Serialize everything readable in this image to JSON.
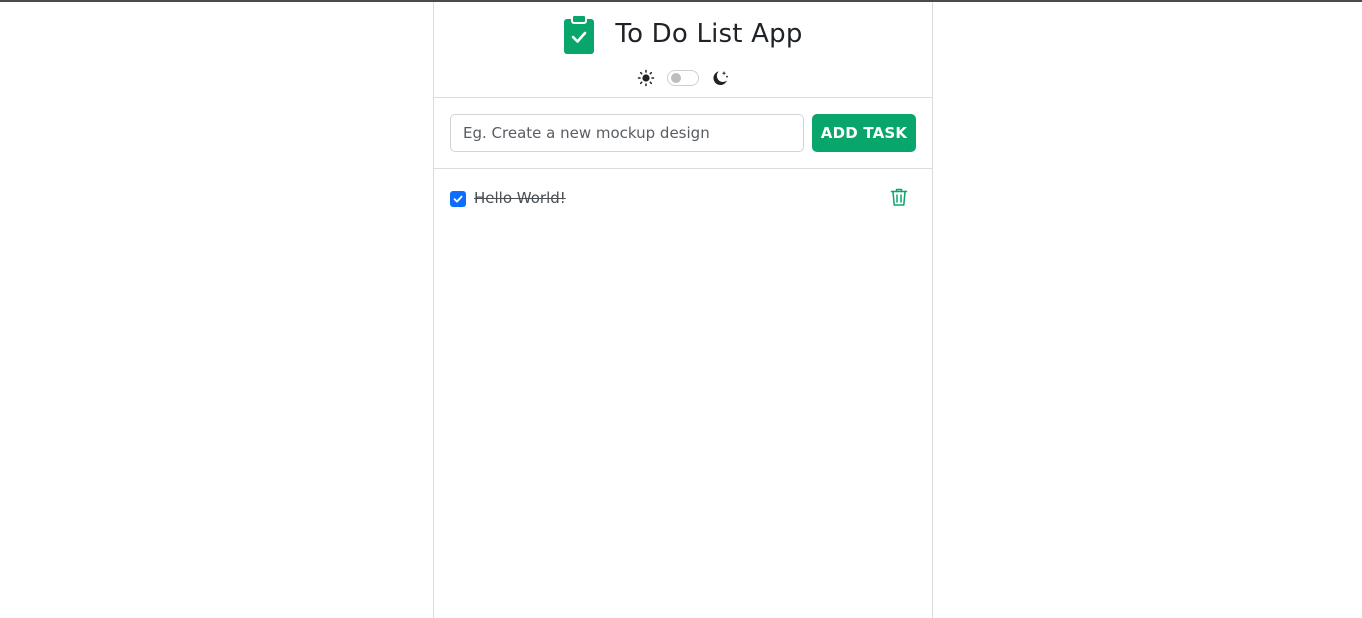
{
  "header": {
    "title": "To Do List App",
    "icons": {
      "logo": "clipboard-check-icon",
      "light_mode": "sun-icon",
      "dark_mode": "moon-stars-icon"
    },
    "theme_toggle": {
      "state": "off"
    }
  },
  "add_task": {
    "placeholder": "Eg. Create a new mockup design",
    "value": "",
    "button_label": "ADD TASK"
  },
  "tasks": [
    {
      "text": "Hello World!",
      "completed": true,
      "delete_icon": "trash-icon"
    }
  ],
  "colors": {
    "accent": "#08a66a",
    "checkbox": "#0d6efd",
    "border": "#dcdcdc"
  }
}
